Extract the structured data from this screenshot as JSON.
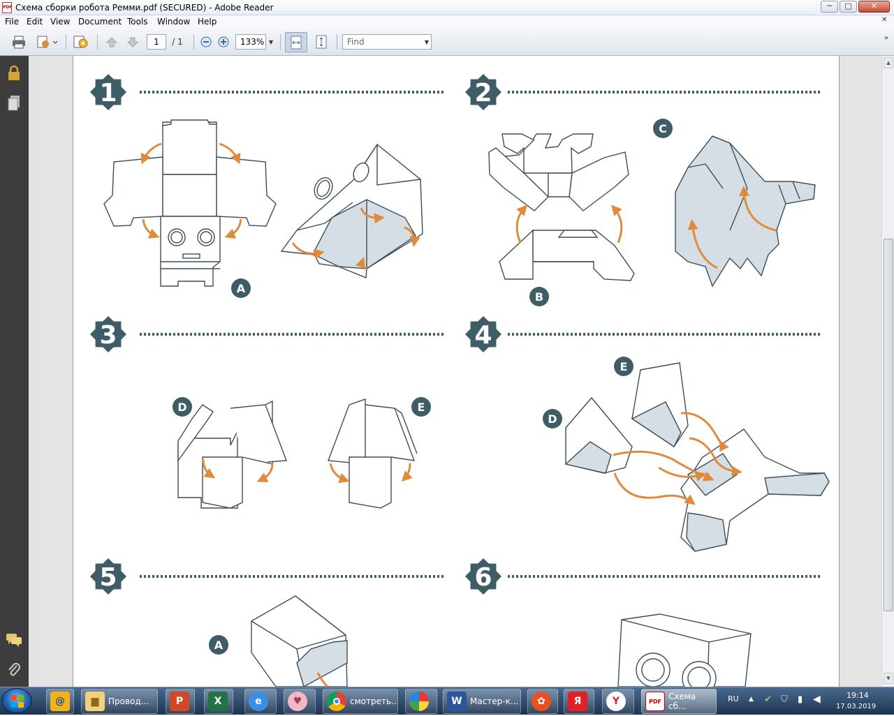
{
  "window": {
    "title": "Схема сборки робота Ремми.pdf (SECURED) - Adobe Reader",
    "min_label": "─",
    "max_label": "□",
    "close_label": "✕"
  },
  "menu": [
    "File",
    "Edit",
    "View",
    "Document",
    "Tools",
    "Window",
    "Help"
  ],
  "toolbar": {
    "page_current": "1",
    "page_total": "/ 1",
    "zoom": "133%",
    "find_placeholder": "Find"
  },
  "document": {
    "steps": [
      "1",
      "2",
      "3",
      "4",
      "5",
      "6"
    ],
    "part_labels": [
      "A",
      "B",
      "C",
      "D",
      "E",
      "D",
      "E",
      "A"
    ],
    "colors": {
      "badge": "#3e5d66",
      "arrow": "#e08a3c",
      "fill": "#d5dee5",
      "line": "#3e4d55"
    }
  },
  "taskbar": {
    "items": [
      {
        "label": "",
        "icon": "mail-icon"
      },
      {
        "label": "Провод...",
        "icon": "folder-icon"
      },
      {
        "label": "",
        "icon": "ppt-icon"
      },
      {
        "label": "",
        "icon": "excel-icon"
      },
      {
        "label": "",
        "icon": "ie-icon"
      },
      {
        "label": "",
        "icon": "pig-icon"
      },
      {
        "label": "смотреть...",
        "icon": "chrome-icon"
      },
      {
        "label": "",
        "icon": "ball-icon"
      },
      {
        "label": "Мастер-к...",
        "icon": "word-icon"
      },
      {
        "label": "",
        "icon": "media-icon"
      },
      {
        "label": "",
        "icon": "yandex-icon"
      },
      {
        "label": "",
        "icon": "yabrowser-icon"
      },
      {
        "label": "Схема сб...",
        "icon": "pdf-icon"
      }
    ],
    "lang": "RU",
    "time": "19:14",
    "date": "17.03.2019"
  }
}
